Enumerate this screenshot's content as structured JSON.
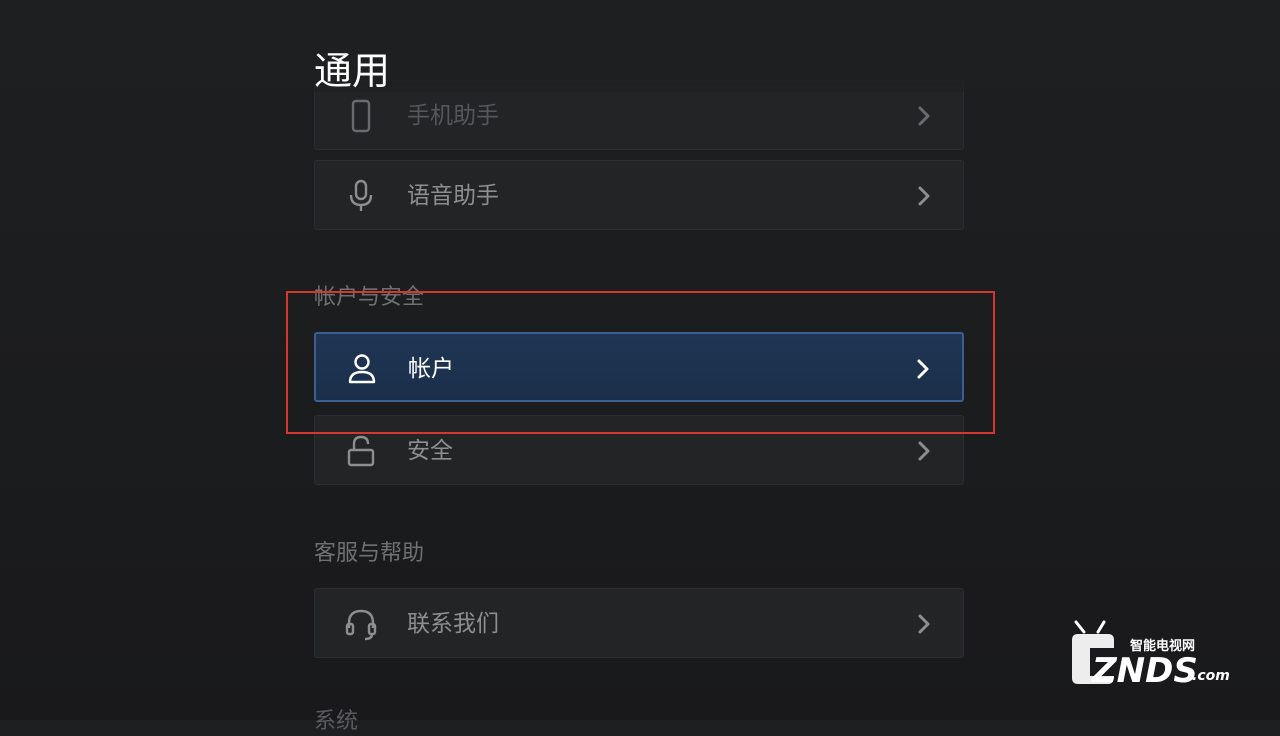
{
  "header": {
    "title": "通用"
  },
  "sections": {
    "assistant": {
      "items": [
        {
          "label": "手机助手",
          "icon": "phone-icon"
        },
        {
          "label": "语音助手",
          "icon": "microphone-icon"
        }
      ]
    },
    "account_security": {
      "header": "帐户与安全",
      "items": [
        {
          "label": "帐户",
          "icon": "user-icon",
          "state": "focused"
        },
        {
          "label": "安全",
          "icon": "lock-icon"
        }
      ]
    },
    "support": {
      "header": "客服与帮助",
      "items": [
        {
          "label": "联系我们",
          "icon": "headset-icon"
        }
      ]
    },
    "system": {
      "header": "系统"
    }
  },
  "watermark": {
    "brand": "ZNDS",
    "domain": ".com",
    "tagline": "智能电视网"
  },
  "colors": {
    "background": "#1e1f21",
    "focus_fill": "#1f3553",
    "focus_border": "#3a5f92",
    "annotation": "#d6362b"
  }
}
